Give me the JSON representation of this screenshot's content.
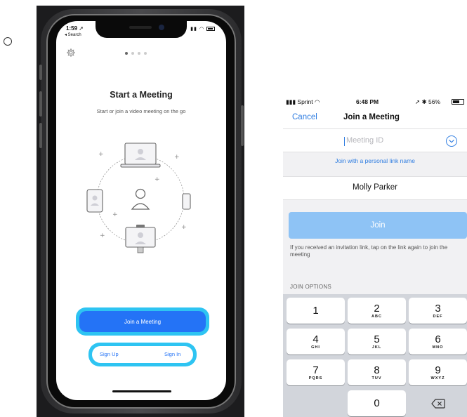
{
  "left_phone": {
    "status": {
      "time": "1:59",
      "back_label": "◂ Search"
    },
    "title": "Start a Meeting",
    "subtitle": "Start or join a video meeting on the go",
    "join_button": "Join a Meeting",
    "sign_up": "Sign Up",
    "sign_in": "Sign In",
    "page_dots": {
      "count": 4,
      "active_index": 0
    }
  },
  "right_phone": {
    "status": {
      "carrier": "Sprint",
      "time": "6:48 PM",
      "battery": "56%"
    },
    "nav": {
      "cancel": "Cancel",
      "title": "Join a Meeting"
    },
    "meeting_id_placeholder": "Meeting ID",
    "personal_link": "Join with a personal link name",
    "name_value": "Molly Parker",
    "join_button": "Join",
    "hint": "If you received an invitation link, tap on the link again to join the meeting",
    "join_options_label": "JOIN OPTIONS",
    "keypad": [
      {
        "digit": "1",
        "letters": ""
      },
      {
        "digit": "2",
        "letters": "ABC"
      },
      {
        "digit": "3",
        "letters": "DEF"
      },
      {
        "digit": "4",
        "letters": "GHI"
      },
      {
        "digit": "5",
        "letters": "JKL"
      },
      {
        "digit": "6",
        "letters": "MNO"
      },
      {
        "digit": "7",
        "letters": "PQRS"
      },
      {
        "digit": "8",
        "letters": "TUV"
      },
      {
        "digit": "9",
        "letters": "WXYZ"
      },
      {
        "digit": "0",
        "letters": ""
      }
    ]
  },
  "colors": {
    "accent_blue": "#2473f6",
    "highlight_cyan": "#2ec4f2",
    "ios_blue": "#2f7de1",
    "join_disabled": "#8ec3f5"
  }
}
